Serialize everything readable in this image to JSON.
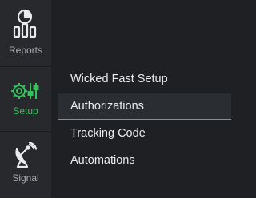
{
  "rail": {
    "items": [
      {
        "label": "Reports",
        "icon": "reports-chart-icon",
        "active": false
      },
      {
        "label": "Setup",
        "icon": "setup-gear-sliders-icon",
        "active": true
      },
      {
        "label": "Signal",
        "icon": "satellite-dish-icon",
        "active": false
      }
    ]
  },
  "submenu": {
    "items": [
      {
        "label": "Wicked Fast Setup",
        "active": false
      },
      {
        "label": "Authorizations",
        "active": true
      },
      {
        "label": "Tracking Code",
        "active": false
      },
      {
        "label": "Automations",
        "active": false
      }
    ]
  },
  "colors": {
    "accent": "#37c15c",
    "rail_background": "#27292d",
    "panel_background": "#1e2023",
    "active_item_background": "#2a2d31",
    "text": "#e9eaec",
    "muted_text": "#a9adb3"
  }
}
